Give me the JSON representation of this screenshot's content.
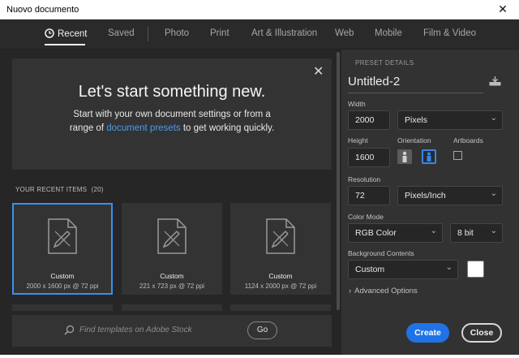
{
  "window": {
    "title": "Nuovo documento",
    "close_glyph": "✕"
  },
  "nav": {
    "tabs": [
      {
        "label": "Recent",
        "icon": "clock-icon",
        "active": true
      },
      {
        "label": "Saved"
      },
      {
        "label": "Photo"
      },
      {
        "label": "Print"
      },
      {
        "label": "Art & Illustration"
      },
      {
        "label": "Web"
      },
      {
        "label": "Mobile"
      },
      {
        "label": "Film & Video"
      }
    ]
  },
  "hero": {
    "title": "Let's start something new.",
    "text_before": "Start with your own document settings or from a range of",
    "link": "document presets",
    "text_after": "to get working quickly.",
    "close_glyph": "✕"
  },
  "recent": {
    "label": "YOUR RECENT ITEMS",
    "count": "(20)",
    "items": [
      {
        "name": "Custom",
        "size": "2000 x 1600 px @ 72 ppi",
        "selected": true
      },
      {
        "name": "Custom",
        "size": "221 x 723 px @ 72 ppi"
      },
      {
        "name": "Custom",
        "size": "1124 x 2000 px @ 72 ppi"
      }
    ]
  },
  "search": {
    "placeholder": "Find templates on Adobe Stock",
    "go_label": "Go"
  },
  "preset": {
    "section_title": "PRESET DETAILS",
    "doc_name": "Untitled-2",
    "width_label": "Width",
    "width_value": "2000",
    "width_unit": "Pixels",
    "height_label": "Height",
    "height_value": "1600",
    "orientation_label": "Orientation",
    "artboards_label": "Artboards",
    "artboards_checked": false,
    "resolution_label": "Resolution",
    "resolution_value": "72",
    "resolution_unit": "Pixels/Inch",
    "color_mode_label": "Color Mode",
    "color_mode_value": "RGB Color",
    "bit_depth_value": "8 bit",
    "bg_label": "Background Contents",
    "bg_value": "Custom",
    "bg_color": "#ffffff",
    "advanced_label": "Advanced Options"
  },
  "actions": {
    "create_label": "Create",
    "close_label": "Close"
  },
  "colors": {
    "accent": "#1f73e6",
    "selection": "#3a8ff0",
    "link": "#4a9cf0",
    "panel": "#323232",
    "background": "#262626"
  }
}
